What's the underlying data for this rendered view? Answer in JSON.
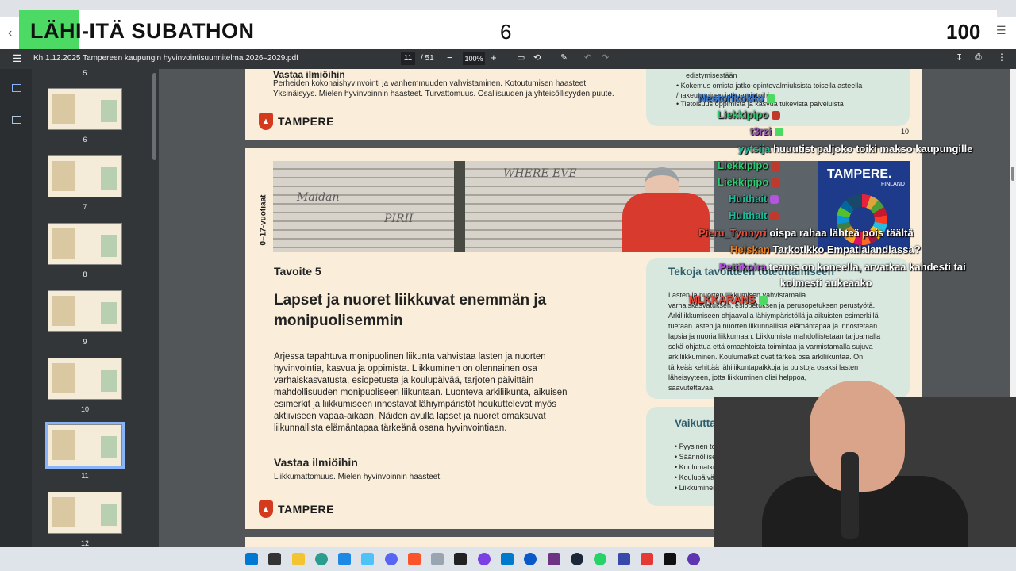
{
  "banner": {
    "title": "LÄHI-ITÄ SUBATHON",
    "center_value": "6",
    "right_value": "100"
  },
  "pdf": {
    "filename": "Kh 1.12.2025 Tampereen kaupungin hyvinvointisuunnitelma 2026–2029.pdf",
    "page_current": "11",
    "page_total": "/ 51",
    "zoom": "100%",
    "thumbnails": [
      {
        "num": "6"
      },
      {
        "num": "7"
      },
      {
        "num": "8"
      },
      {
        "num": "9"
      },
      {
        "num": "10"
      },
      {
        "num": "11"
      },
      {
        "num": "12"
      }
    ],
    "selected_thumbnail": "11",
    "top_thumbnail_num": "5"
  },
  "page10": {
    "heading": "Vastaa ilmiöihin",
    "text_line1": "Perheiden kokonaishyvinvointi ja vanhemmuuden vahvistaminen. Kotoutumisen haasteet.",
    "text_line2": "Yksinäisyys. Mielen hyvinvoinnin haasteet. Turvattomuus. Osallisuuden ja yhteisöllisyyden puute.",
    "logo": "TAMPERE",
    "bullets": [
      "edistymisestään",
      "Kokemus omista jatko-opintovalmiuksista toisella asteella /hakeutuminen jatko-opintoihin",
      "Tietoisuus oppimista ja kasvua tukevista palveluista"
    ],
    "page_number": "10"
  },
  "page11": {
    "side_label": "0–17-vuotiaat",
    "goal_label": "Tavoite 5",
    "goal_title_line1": "Lapset ja nuoret liikkuvat enemmän ja",
    "goal_title_line2": "monipuolisemmin",
    "body": [
      "Arjessa tapahtuva monipuolinen liikunta vahvistaa lasten ja nuorten",
      "hyvinvointia, kasvua ja oppimista. Liikkuminen on olennainen osa",
      "varhaiskasvatusta, esiopetusta ja koulupäivää, tarjoten päivittäin",
      "mahdollisuuden monipuoliseen liikuntaan. Luonteva arkiliikunta, aikuisen",
      "esimerkit ja liikkumiseen innostavat lähiympäristöt houkuttelevat myös",
      "aktiiviseen vapaa-aikaan. Näiden avulla lapset ja nuoret omaksuvat",
      "liikunnallista elämäntapaa tärkeänä osana hyvinvointiaan."
    ],
    "phenomena_heading": "Vastaa ilmiöihin",
    "phenomena_text": "Liikkumattomuus. Mielen hyvinvoinnin haasteet.",
    "actions_heading": "Tekoja tavoitteen toteuttamiseen",
    "actions_lines": [
      "Lasten ja nuorten liikkumisen vahvistamalla",
      "varhaiskasvatuksen, esiopetuksen  ja perusopetuksen perustyötä.",
      "Arkiliikkumiseen ohjaavalla lähiympäristöllä ja aikuisten esimerkillä",
      "tuetaan lasten ja nuorten liikunnallista elämäntapaa ja innostetaan",
      "lapsia ja nuoria liikkumaan. Liikkumista mahdollistetaan tarjoamalla",
      "sekä ohjattua että omaehtoista toimintaa ja varmistamalla sujuva",
      "arkiliikkuminen. Koulumatkat ovat tärkeä osa arkiliikuntaa. On",
      "tärkeää kehittää lähiliikuntapaikkoja ja puistoja osaksi lasten",
      "läheisyyteen, jotta liikkuminen olisi helppoa, ",
      "saavutettavaa."
    ],
    "metrics_heading": "Vaikuttavuuden mittarit",
    "metrics": [
      "Fyysinen toimintakyky",
      "Säännöllisen/ hengästy",
      "Koulumatkojen kulku",
      "Koulupäiväisen aktii",
      "Liikkuminen osana"
    ],
    "logo": "TAMPERE",
    "card_title": "TAMPERE.",
    "card_sub": "FINLAND"
  },
  "chat": [
    {
      "name": "Nestorikokko",
      "msg": "",
      "color": "#3a7bd5",
      "badge": "#4cd964"
    },
    {
      "name": "Liekkipipo",
      "msg": "",
      "color": "#2ecc71",
      "badge": "#c0392b"
    },
    {
      "name": "t3rzi",
      "msg": "",
      "color": "#9b59b6",
      "badge": "#4cd964"
    },
    {
      "name": "yytsija",
      "msg": "huuutist paljoko toiki makso kaupungille",
      "color": "#1abc9c",
      "badge": ""
    },
    {
      "name": "Liekkipipo",
      "msg": "",
      "color": "#2ecc71",
      "badge": "#c0392b"
    },
    {
      "name": "Liekkipipo",
      "msg": "",
      "color": "#2ecc71",
      "badge": "#c0392b"
    },
    {
      "name": "Huithait",
      "msg": "",
      "color": "#1abc9c",
      "badge": "#b455e0"
    },
    {
      "name": "Huithait",
      "msg": "",
      "color": "#1abc9c",
      "badge": "#c0392b"
    },
    {
      "name": "Pieru_Tynnyri",
      "msg": "oispa rahaa lähteä pois täältä",
      "color": "#e74c3c",
      "badge": ""
    },
    {
      "name": "Heiskan",
      "msg": "Tarkotikko Empatialandiassa?",
      "color": "#e67e22",
      "badge": ""
    },
    {
      "name": "Pettikoira",
      "msg": "teams on koneella, arvatkaa kahdesti tai",
      "color": "#b455e0",
      "badge": ""
    },
    {
      "name": "",
      "msg": "kolmesti aukeaako",
      "color": "#ffffff",
      "badge": ""
    },
    {
      "name": "MLKKARANS",
      "msg": "",
      "color": "#e74c3c",
      "badge": "#4cd964"
    }
  ]
}
